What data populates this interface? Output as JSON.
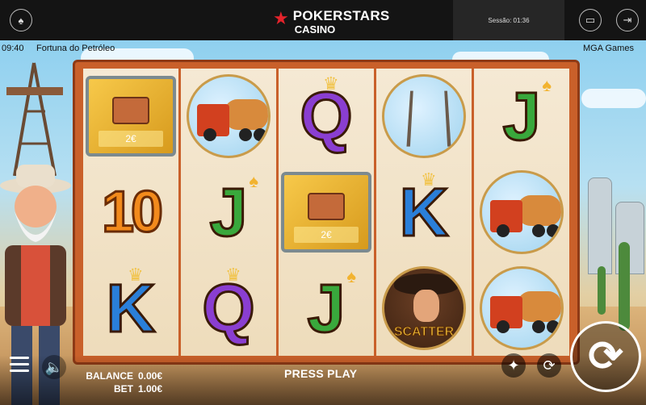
{
  "topbar": {
    "brand_name": "POKERSTARS",
    "brand_sub": "CASINO",
    "session_label": "Sessão:",
    "session_time": "01:36"
  },
  "game": {
    "clock": "09:40",
    "title": "Fortuna do Petróleo",
    "provider": "MGA Games"
  },
  "reels": [
    [
      {
        "type": "coin",
        "value": "2€"
      },
      {
        "type": "letter",
        "text": "10",
        "color": "#f28a1c"
      },
      {
        "type": "letter",
        "text": "K",
        "color": "#2a7fd9",
        "crown": true
      }
    ],
    [
      {
        "type": "truck"
      },
      {
        "type": "letter",
        "text": "J",
        "color": "#39a83c",
        "spade": true
      },
      {
        "type": "letter",
        "text": "Q",
        "color": "#8a3ed1",
        "crown": true
      }
    ],
    [
      {
        "type": "letter",
        "text": "Q",
        "color": "#8a3ed1",
        "crown": true
      },
      {
        "type": "coin",
        "value": "2€"
      },
      {
        "type": "letter",
        "text": "J",
        "color": "#39a83c",
        "spade": true
      }
    ],
    [
      {
        "type": "rig"
      },
      {
        "type": "letter",
        "text": "K",
        "color": "#2a7fd9",
        "crown": true
      },
      {
        "type": "scatter",
        "label": "SCATTER"
      }
    ],
    [
      {
        "type": "letter",
        "text": "J",
        "color": "#39a83c",
        "spade": true
      },
      {
        "type": "truck"
      },
      {
        "type": "truck"
      }
    ]
  ],
  "hud": {
    "balance_label": "BALANCE",
    "balance_value": "0.00€",
    "bet_label": "BET",
    "bet_value": "1.00€",
    "press_play": "PRESS PLAY"
  },
  "icons": {
    "spade_logo": "spade-icon",
    "cashier": "cashier-icon",
    "exit": "exit-icon",
    "menu": "menu-icon",
    "sound": "speaker-icon",
    "bet_settings": "chip-icon",
    "autoplay": "autoplay-icon",
    "spin": "spin-icon"
  },
  "colors": {
    "brand_red": "#e4232b",
    "topbar_bg": "#141414",
    "frame": "#c9602a"
  }
}
